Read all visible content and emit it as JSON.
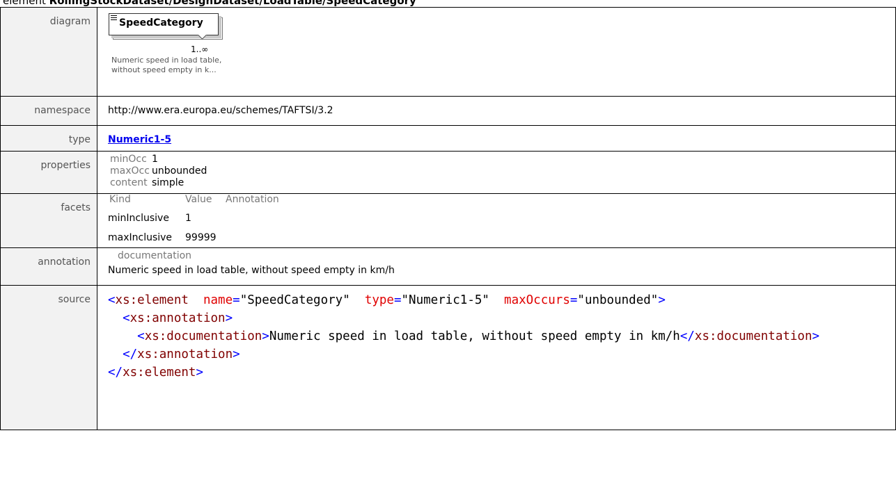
{
  "page": {
    "heading_prefix": "element",
    "heading_path": "RollingStockDataset/DesignDataset/LoadTable/SpeedCategory"
  },
  "labels": {
    "diagram": "diagram",
    "namespace": "namespace",
    "type": "type",
    "properties": "properties",
    "facets": "facets",
    "annotation": "annotation",
    "source": "source"
  },
  "diagram": {
    "element_name": "SpeedCategory",
    "occurrence": "1..∞",
    "note_line1": "Numeric speed in load table,",
    "note_line2": "without speed empty in k..."
  },
  "namespace": "http://www.era.europa.eu/schemes/TAFTSI/3.2",
  "type": "Numeric1-5",
  "properties": [
    {
      "key": "minOcc",
      "value": "1"
    },
    {
      "key": "maxOcc",
      "value": "unbounded"
    },
    {
      "key": "content",
      "value": "simple"
    }
  ],
  "facets": {
    "headers": [
      "Kind",
      "Value",
      "Annotation"
    ],
    "rows": [
      {
        "kind": "minInclusive",
        "value": "1",
        "annotation": ""
      },
      {
        "kind": "maxInclusive",
        "value": "99999",
        "annotation": ""
      }
    ]
  },
  "annotation": {
    "header": "documentation",
    "text": "Numeric speed in load table, without speed empty in km/h"
  },
  "source": {
    "el": "xs:element",
    "name_attr": "name",
    "name_val": "\"SpeedCategory\"",
    "type_attr": "type",
    "type_val": "\"Numeric1-5\"",
    "max_attr": "maxOccurs",
    "max_val": "\"unbounded\"",
    "ann": "xs:annotation",
    "doc": "xs:documentation",
    "doc_text": "Numeric speed in load table, without speed empty in km/h"
  }
}
